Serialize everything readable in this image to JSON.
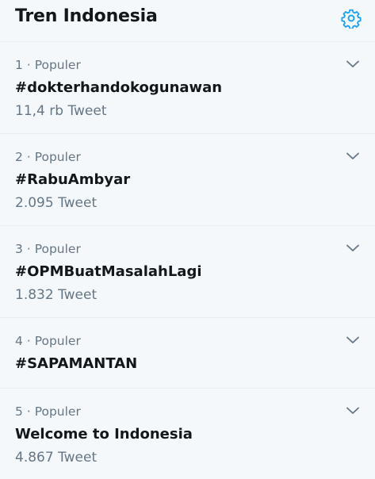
{
  "header": {
    "title": "Tren Indonesia",
    "settings_icon": "gear-icon",
    "accent_color": "#1da1f2"
  },
  "trends": [
    {
      "rank": "1",
      "separator": "·",
      "context": "Populer",
      "name": "#dokterhandokogunawan",
      "count": "11,4 rb Tweet"
    },
    {
      "rank": "2",
      "separator": "·",
      "context": "Populer",
      "name": "#RabuAmbyar",
      "count": "2.095 Tweet"
    },
    {
      "rank": "3",
      "separator": "·",
      "context": "Populer",
      "name": "#OPMBuatMasalahLagi",
      "count": "1.832 Tweet"
    },
    {
      "rank": "4",
      "separator": "·",
      "context": "Populer",
      "name": "#SAPAMANTAN"
    },
    {
      "rank": "5",
      "separator": "·",
      "context": "Populer",
      "name": "Welcome to Indonesia",
      "count": "4.867 Tweet"
    }
  ],
  "icons": {
    "trend_menu": "chevron-down-icon"
  }
}
